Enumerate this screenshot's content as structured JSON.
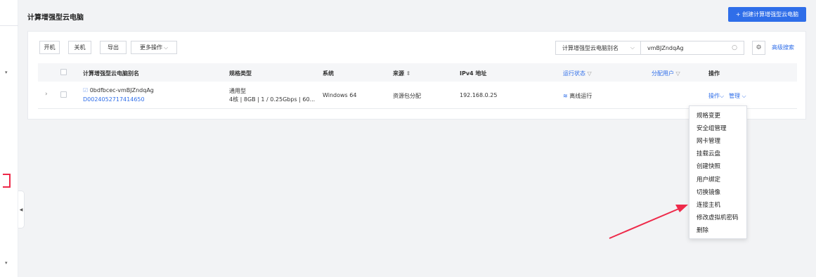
{
  "page": {
    "title": "计算增强型云电脑"
  },
  "header": {
    "create_button": "+ 创建计算增强型云电脑"
  },
  "toolbar": {
    "start": "开机",
    "shutdown": "关机",
    "export": "导出",
    "more": "更多操作"
  },
  "filter": {
    "field": "计算增强型云电脑别名",
    "value": "vmBJZndqAg",
    "advanced": "高级搜索"
  },
  "table": {
    "headers": {
      "name": "计算增强型云电脑别名",
      "spec": "规格类型",
      "os": "系统",
      "source": "来源",
      "ipv4": "IPv4 地址",
      "status": "运行状态",
      "user": "分配用户",
      "actions": "操作"
    },
    "rows": [
      {
        "name": "0bdfbcec-vmBJZndqAg",
        "id": "D0024052717414650",
        "spec_type": "通用型",
        "spec_detail": "4核 | 8GB | 1 / 0.25Gbps | 60...",
        "os": "Windows 64",
        "source": "资源包分配",
        "ipv4": "192.168.0.25",
        "status": "离线运行",
        "user": "",
        "op_action": "操作",
        "op_manage": "管理"
      }
    ]
  },
  "dropdown": {
    "items": [
      "规格变更",
      "安全组管理",
      "网卡管理",
      "挂载云盘",
      "创建快照",
      "用户绑定",
      "切换镜像",
      "连接主机",
      "修改虚拟机密码",
      "删除"
    ]
  },
  "colors": {
    "accent": "#2f6ee9",
    "annotation": "#ee2a4a"
  },
  "icons": [
    "search-icon",
    "gear-icon",
    "edit-icon",
    "wifi-icon",
    "sort-icon",
    "filter-icon",
    "chevron-down-icon",
    "chevron-right-icon",
    "chevron-left-icon"
  ]
}
